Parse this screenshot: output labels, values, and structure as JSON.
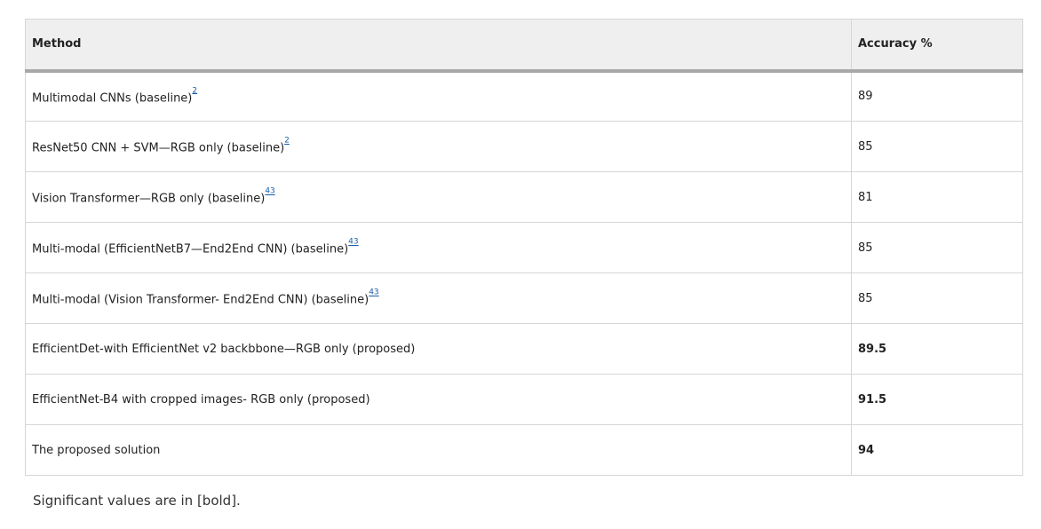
{
  "table": {
    "headers": {
      "method": "Method",
      "accuracy": "Accuracy %"
    },
    "rows": [
      {
        "method": "Multimodal CNNs (baseline)",
        "ref": "2",
        "accuracy": "89",
        "bold": false
      },
      {
        "method": "ResNet50 CNN + SVM—RGB only (baseline)",
        "ref": "2",
        "accuracy": "85",
        "bold": false
      },
      {
        "method": "Vision Transformer—RGB only (baseline)",
        "ref": "43",
        "accuracy": "81",
        "bold": false
      },
      {
        "method": "Multi-modal (EfficientNetB7—End2End CNN) (baseline)",
        "ref": "43",
        "accuracy": "85",
        "bold": false
      },
      {
        "method": "Multi-modal (Vision Transformer- End2End CNN) (baseline)",
        "ref": "43",
        "accuracy": "85",
        "bold": false
      },
      {
        "method": "EfficientDet-with EfficientNet v2 backbbone—RGB only (proposed)",
        "ref": "",
        "accuracy": "89.5",
        "bold": true
      },
      {
        "method": "EfficientNet-B4 with cropped images- RGB only (proposed)",
        "ref": "",
        "accuracy": "91.5",
        "bold": true
      },
      {
        "method": "The proposed solution",
        "ref": "",
        "accuracy": "94",
        "bold": true
      }
    ]
  },
  "footnote": "Significant values are in [bold].",
  "colors": {
    "header_bg": "#efefef",
    "border": "#d6d6d6",
    "header_rule": "#a8a8a8",
    "link": "#1a5ea8"
  }
}
